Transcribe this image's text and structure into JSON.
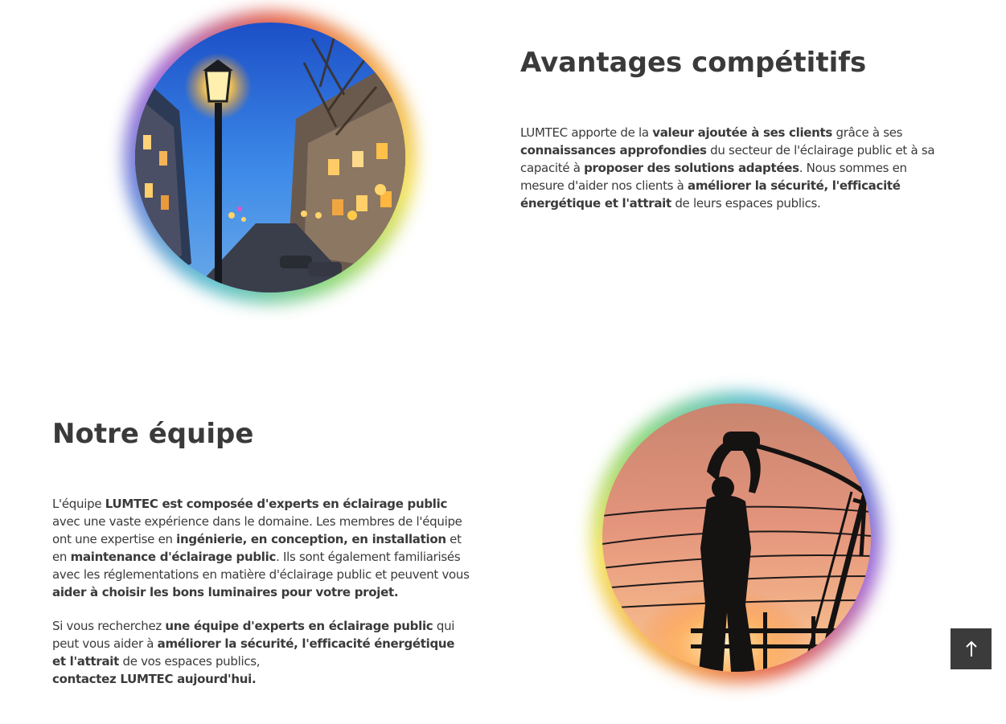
{
  "advantages": {
    "title": "Avantages compétitifs",
    "p1": "LUMTEC apporte de la ",
    "b1": "valeur ajoutée à ses clients",
    "p2": " grâce à ses ",
    "b2": "connaissances approfondies",
    "p3": " du secteur de l'éclairage public et à sa capacité à ",
    "b3": "proposer des solutions adaptées",
    "p4": ". Nous sommes en mesure d'aider nos clients à ",
    "b4": "améliorer la sécurité, l'efficacité énergétique et l'attrait",
    "p5": " de leurs espaces publics."
  },
  "team": {
    "title": "Notre équipe",
    "para1": {
      "t1": "L'équipe ",
      "b1": "LUMTEC est composée d'experts en éclairage public",
      "t2": " avec une vaste expérience dans le domaine. Les membres de l'équipe ont une expertise en ",
      "b2": "ingénierie, en conception, en installation",
      "t3": " et en ",
      "b3": "maintenance d'éclairage public",
      "t4": ". Ils sont également familiarisés avec les réglementations en matière d'éclairage public et peuvent vous ",
      "b4": "aider à choisir les bons luminaires pour votre projet."
    },
    "para2": {
      "t1": "Si vous recherchez ",
      "b1": "une équipe d'experts en éclairage public",
      "t2": " qui peut vous aider à ",
      "b2": "améliorer la sécurité, l'efficacité énergétique et l'attrait",
      "t3": " de vos espaces publics,",
      "b3": "contactez LUMTEC aujourd'hui."
    }
  },
  "icons": {
    "back_to_top": "arrow-up-icon"
  }
}
